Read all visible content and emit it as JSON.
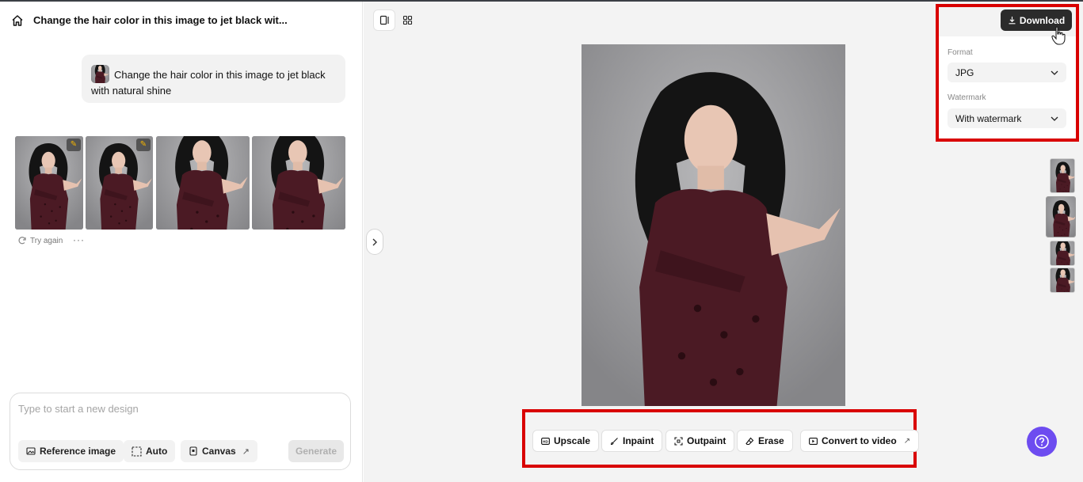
{
  "conversation": {
    "title": "Change the hair color in this image to jet black wit...",
    "message": "Change the hair color in this image to jet black with natural shine"
  },
  "results": {
    "try_again": "Try again",
    "more": "···"
  },
  "prompt": {
    "placeholder": "Type to start a new design",
    "reference_image": "Reference image",
    "auto": "Auto",
    "canvas": "Canvas",
    "generate": "Generate"
  },
  "toolbar": {
    "upscale": "Upscale",
    "inpaint": "Inpaint",
    "outpaint": "Outpaint",
    "erase": "Erase",
    "convert_to_video": "Convert to video"
  },
  "download": {
    "button": "Download",
    "format_label": "Format",
    "format_value": "JPG",
    "watermark_label": "Watermark",
    "watermark_value": "With watermark"
  },
  "colors": {
    "highlight": "#d90000",
    "accent": "#6d4cf0",
    "dark_button": "#2b2b2b"
  }
}
